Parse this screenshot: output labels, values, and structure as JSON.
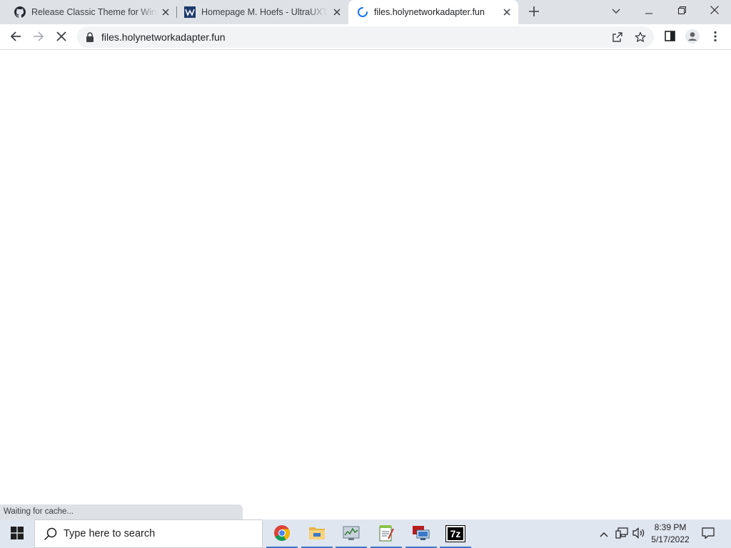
{
  "tabs": [
    {
      "title": "Release Classic Theme for Windows",
      "favicon": "github-icon",
      "active": false
    },
    {
      "title": "Homepage M. Hoefs - UltraUXThemePatcher",
      "favicon": "ultrauxtheme-icon",
      "active": false
    },
    {
      "title": "files.holynetworkadapter.fun",
      "favicon": "loading-spinner-icon",
      "active": true
    }
  ],
  "toolbar": {
    "url": "files.holynetworkadapter.fun",
    "icons": [
      "back-arrow-icon",
      "forward-arrow-icon",
      "stop-loading-icon",
      "lock-icon",
      "share-icon",
      "bookmark-star-icon",
      "side-panel-icon",
      "profile-icon",
      "more-menu-icon"
    ]
  },
  "status": {
    "text": "Waiting for cache..."
  },
  "taskbar": {
    "search_placeholder": "Type here to search",
    "apps": [
      "chrome-icon",
      "file-explorer-icon",
      "task-manager-icon",
      "notepad-icon",
      "remote-desktop-icon",
      "7zip-icon"
    ],
    "seven_zip_label": "7z",
    "time": "8:39 PM",
    "date": "5/17/2022"
  },
  "colors": {
    "tab_strip": "#dee1e6",
    "accent": "#1a73e8",
    "taskbar": "#dfe6f0"
  }
}
